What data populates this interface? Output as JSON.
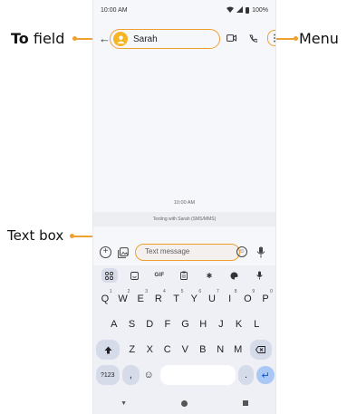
{
  "callouts": {
    "to_bold": "To",
    "to_rest": " field",
    "menu": "Menu",
    "text_box": "Text box"
  },
  "status_bar": {
    "time": "10:00 AM",
    "battery": "100%"
  },
  "app_bar": {
    "contact_name": "Sarah",
    "icons": [
      "back-arrow-icon",
      "avatar",
      "video-call-icon",
      "phone-icon",
      "more-vert-icon"
    ]
  },
  "conversation": {
    "timestamp": "10:00 AM",
    "texting_with": "Texting with Sarah (SMS/MMS)"
  },
  "compose": {
    "placeholder": "Text message"
  },
  "keyboard": {
    "toolbar": [
      "grid-icon",
      "sticker-icon",
      "GIF",
      "clipboard-icon",
      "settings-icon",
      "palette-icon",
      "mic-icon"
    ],
    "gif_label": "GIF",
    "row1": [
      "Q",
      "W",
      "E",
      "R",
      "T",
      "Y",
      "U",
      "I",
      "O",
      "P"
    ],
    "row1_hints": [
      "1",
      "2",
      "3",
      "4",
      "5",
      "6",
      "7",
      "8",
      "9",
      "0"
    ],
    "row2": [
      "A",
      "S",
      "D",
      "F",
      "G",
      "H",
      "J",
      "K",
      "L"
    ],
    "row3": [
      "Z",
      "X",
      "C",
      "V",
      "B",
      "N",
      "M"
    ],
    "symbols_label": "?123",
    "comma": ",",
    "period": "."
  },
  "colors": {
    "callout_accent": "#f0a030",
    "avatar": "#f5b524",
    "enter_key": "#a9c8f5"
  }
}
